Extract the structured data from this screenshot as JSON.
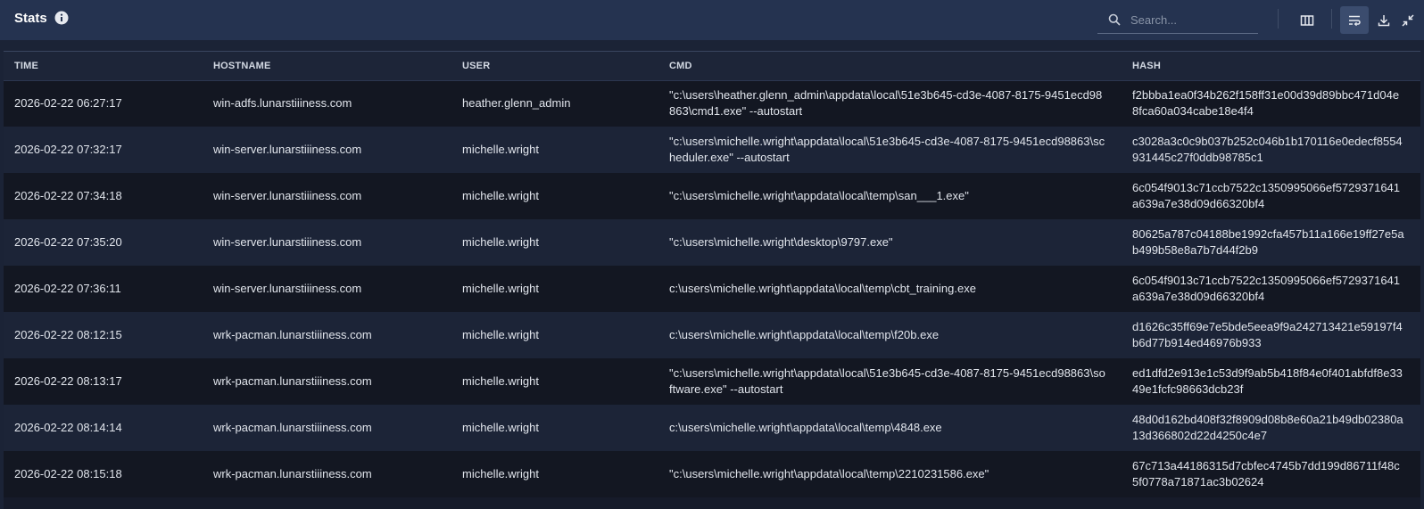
{
  "header": {
    "title": "Stats",
    "search_placeholder": "Search...",
    "toolbar": {
      "columns_icon": "columns-icon",
      "wrap_icon": "wrap-text-icon",
      "download_icon": "download-icon",
      "collapse_icon": "collapse-icon"
    }
  },
  "colors": {
    "header_bg": "#253350",
    "row_odd": "#131722",
    "row_even": "#1c2437",
    "active_button": "#3b4c6e"
  },
  "table": {
    "columns": [
      "TIME",
      "HOSTNAME",
      "USER",
      "CMD",
      "HASH"
    ],
    "rows": [
      [
        "2026-02-22 06:27:17",
        "win-adfs.lunarstiiiness.com",
        "heather.glenn_admin",
        "\"c:\\users\\heather.glenn_admin\\appdata\\local\\51e3b645-cd3e-4087-8175-9451ecd98863\\cmd1.exe\" --autostart",
        "f2bbba1ea0f34b262f158ff31e00d39d89bbc471d04e8fca60a034cabe18e4f4"
      ],
      [
        "2026-02-22 07:32:17",
        "win-server.lunarstiiiness.com",
        "michelle.wright",
        "\"c:\\users\\michelle.wright\\appdata\\local\\51e3b645-cd3e-4087-8175-9451ecd98863\\scheduler.exe\" --autostart",
        "c3028a3c0c9b037b252c046b1b170116e0edecf8554931445c27f0ddb98785c1"
      ],
      [
        "2026-02-22 07:34:18",
        "win-server.lunarstiiiness.com",
        "michelle.wright",
        "\"c:\\users\\michelle.wright\\appdata\\local\\temp\\san___1.exe\"",
        "6c054f9013c71ccb7522c1350995066ef5729371641a639a7e38d09d66320bf4"
      ],
      [
        "2026-02-22 07:35:20",
        "win-server.lunarstiiiness.com",
        "michelle.wright",
        "\"c:\\users\\michelle.wright\\desktop\\9797.exe\"",
        "80625a787c04188be1992cfa457b11a166e19ff27e5ab499b58e8a7b7d44f2b9"
      ],
      [
        "2026-02-22 07:36:11",
        "win-server.lunarstiiiness.com",
        "michelle.wright",
        "c:\\users\\michelle.wright\\appdata\\local\\temp\\cbt_training.exe",
        "6c054f9013c71ccb7522c1350995066ef5729371641a639a7e38d09d66320bf4"
      ],
      [
        "2026-02-22 08:12:15",
        "wrk-pacman.lunarstiiiness.com",
        "michelle.wright",
        "c:\\users\\michelle.wright\\appdata\\local\\temp\\f20b.exe",
        "d1626c35ff69e7e5bde5eea9f9a242713421e59197f4b6d77b914ed46976b933"
      ],
      [
        "2026-02-22 08:13:17",
        "wrk-pacman.lunarstiiiness.com",
        "michelle.wright",
        "\"c:\\users\\michelle.wright\\appdata\\local\\51e3b645-cd3e-4087-8175-9451ecd98863\\software.exe\" --autostart",
        "ed1dfd2e913e1c53d9f9ab5b418f84e0f401abfdf8e3349e1fcfc98663dcb23f"
      ],
      [
        "2026-02-22 08:14:14",
        "wrk-pacman.lunarstiiiness.com",
        "michelle.wright",
        "c:\\users\\michelle.wright\\appdata\\local\\temp\\4848.exe",
        "48d0d162bd408f32f8909d08b8e60a21b49db02380a13d366802d22d4250c4e7"
      ],
      [
        "2026-02-22 08:15:18",
        "wrk-pacman.lunarstiiiness.com",
        "michelle.wright",
        "\"c:\\users\\michelle.wright\\appdata\\local\\temp\\2210231586.exe\"",
        "67c713a44186315d7cbfec4745b7dd199d86711f48c5f0778a71871ac3b02624"
      ]
    ]
  }
}
